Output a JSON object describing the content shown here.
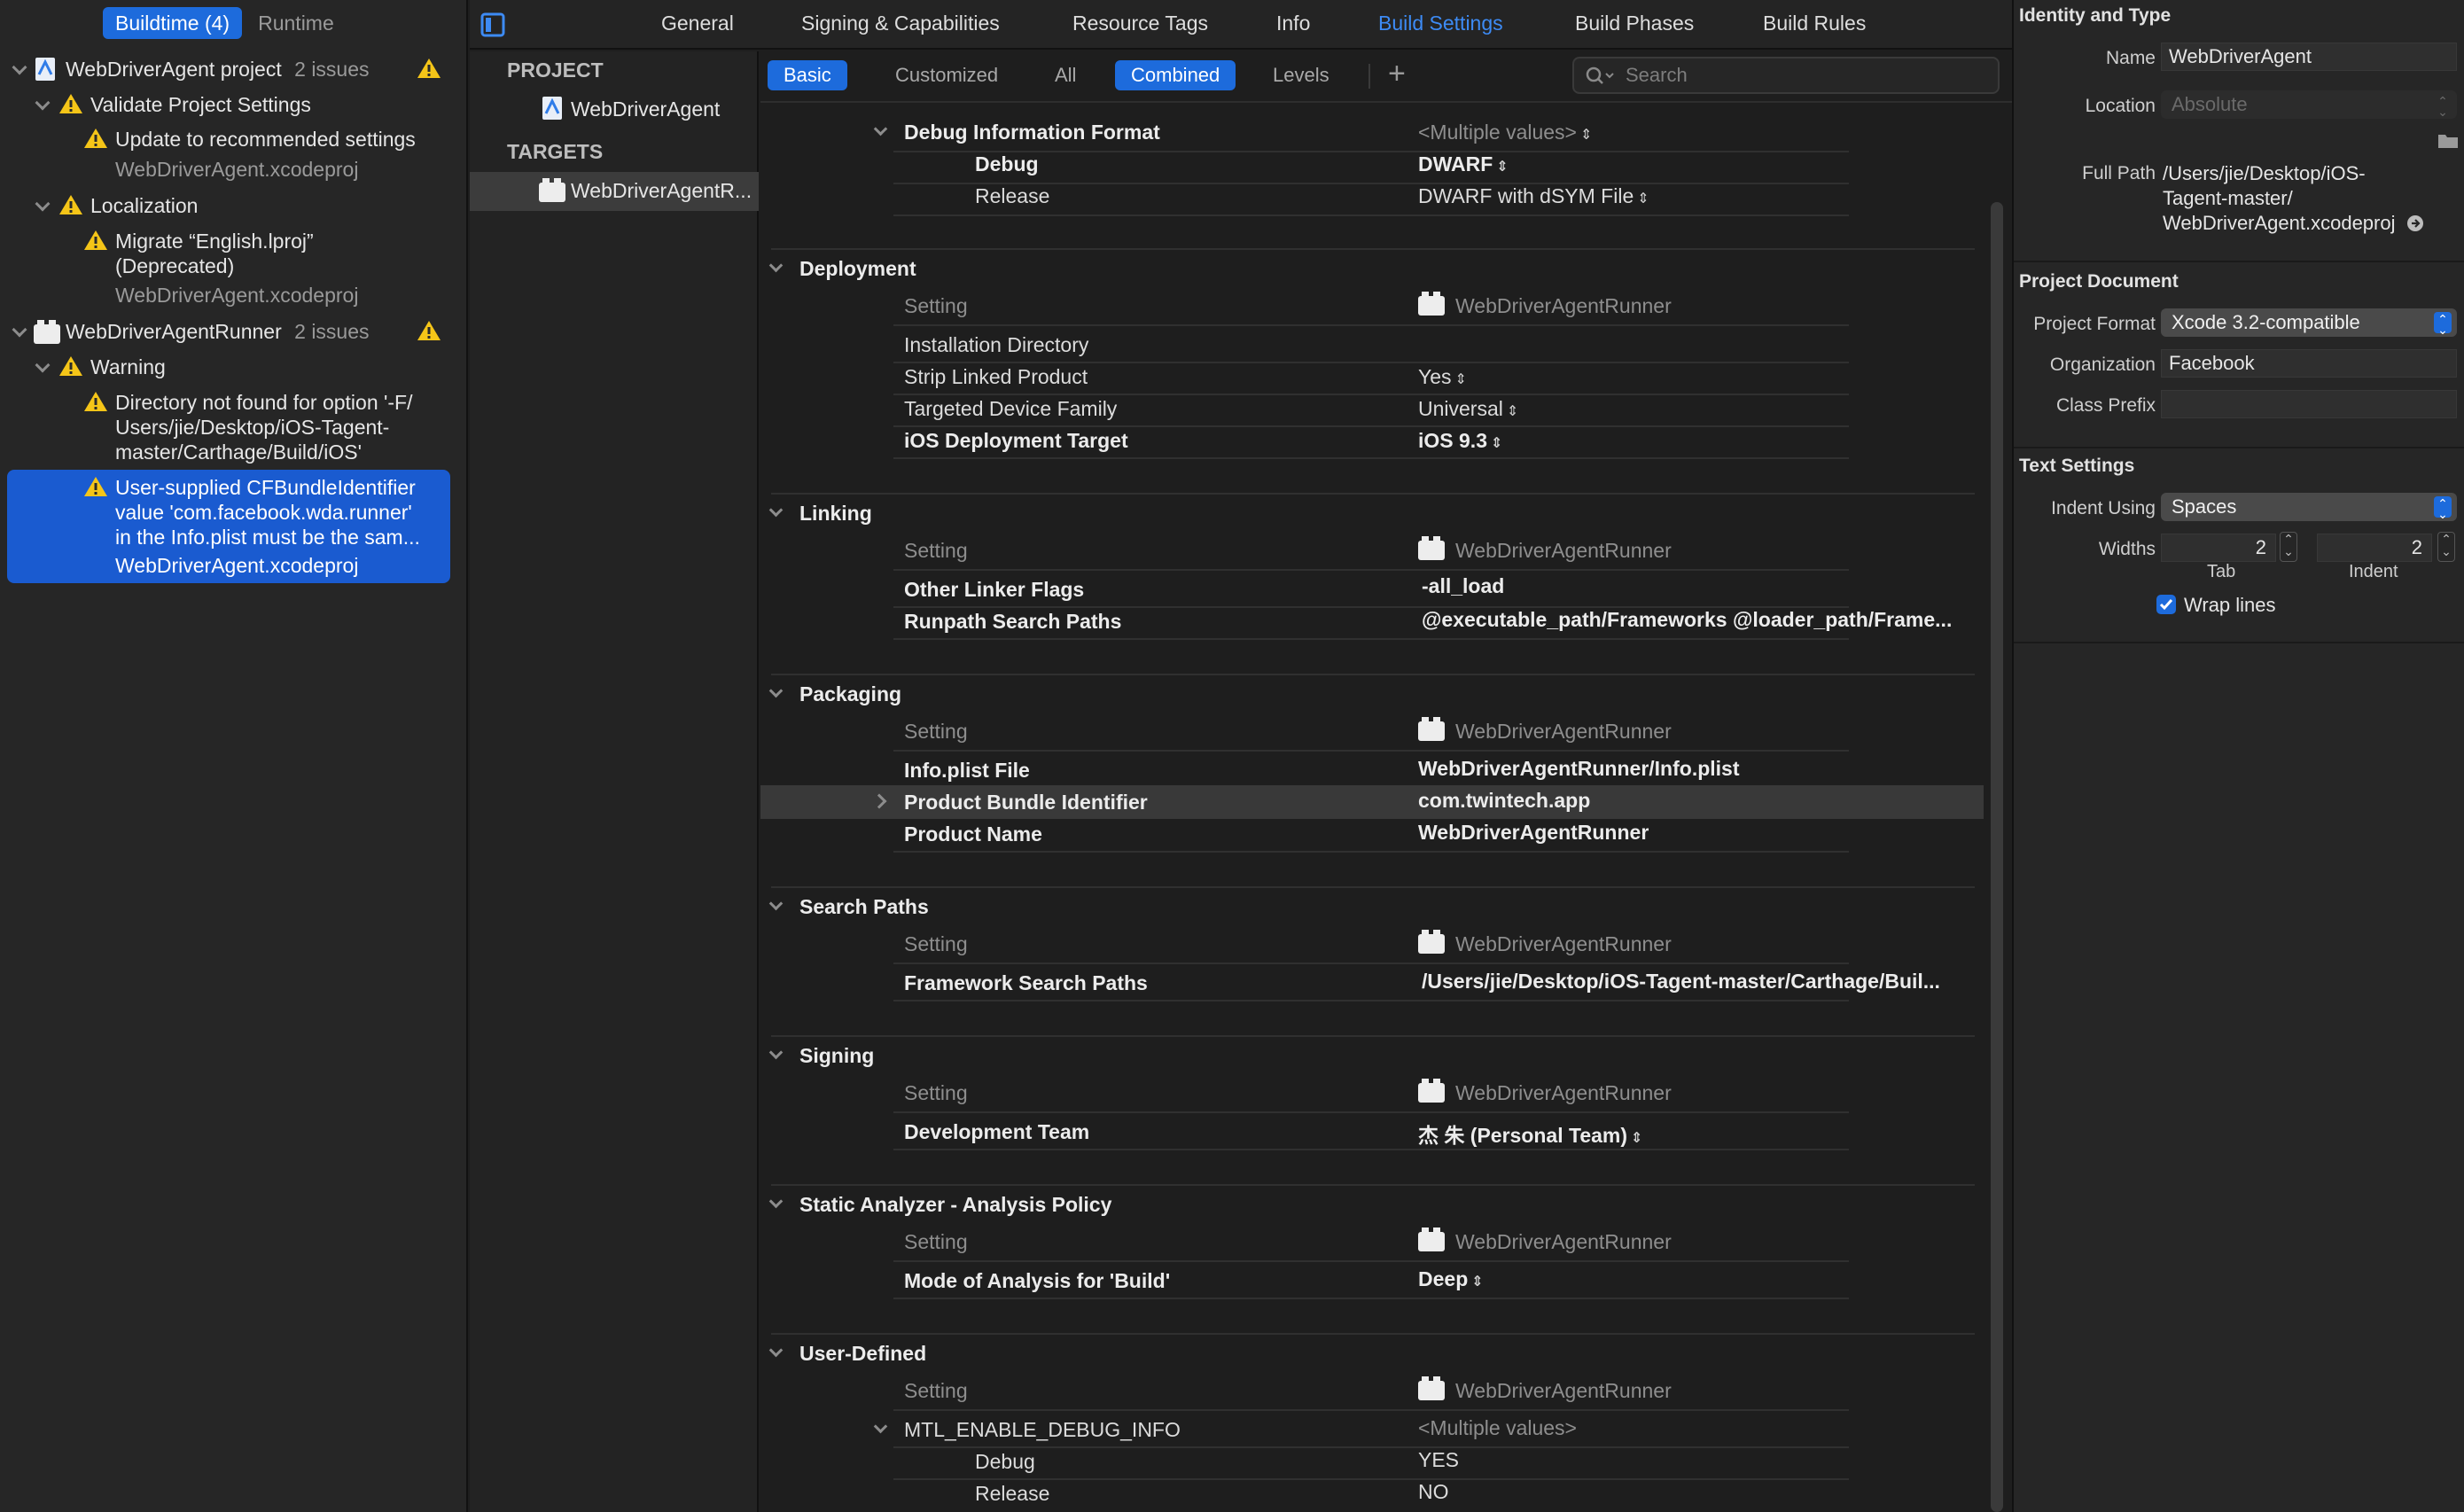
{
  "issues_nav": {
    "segments": [
      "Buildtime (4)",
      "Runtime"
    ],
    "project": {
      "name": "WebDriverAgent project",
      "count": "2 issues"
    },
    "validate_group": "Validate Project Settings",
    "update_item": "Update to recommended settings",
    "update_file": "WebDriverAgent.xcodeproj",
    "localization_group": "Localization",
    "migrate_line1": "Migrate “English.lproj”",
    "migrate_line2": "(Deprecated)",
    "migrate_file": "WebDriverAgent.xcodeproj",
    "runner": {
      "name": "WebDriverAgentRunner",
      "count": "2 issues"
    },
    "warning_group": "Warning",
    "dir_line1": "Directory not found for option '-F/",
    "dir_line2": "Users/jie/Desktop/iOS-Tagent-",
    "dir_line3": "master/Carthage/Build/iOS'",
    "bundle_line1": "User-supplied CFBundleIdentifier",
    "bundle_line2": "value 'com.facebook.wda.runner'",
    "bundle_line3": "in the Info.plist must be the sam...",
    "bundle_file": "WebDriverAgent.xcodeproj"
  },
  "project_list": {
    "project_header": "PROJECT",
    "project_item": "WebDriverAgent",
    "targets_header": "TARGETS",
    "target_item": "WebDriverAgentR..."
  },
  "tabs": [
    "General",
    "Signing & Capabilities",
    "Resource Tags",
    "Info",
    "Build Settings",
    "Build Phases",
    "Build Rules"
  ],
  "filters": {
    "basic": "Basic",
    "customized": "Customized",
    "all": "All",
    "combined": "Combined",
    "levels": "Levels",
    "search_placeholder": "Search"
  },
  "settings": {
    "debug_info": {
      "label": "Debug Information Format",
      "value": "<Multiple values>",
      "debug_label": "Debug",
      "debug_value": "DWARF",
      "release_label": "Release",
      "release_value": "DWARF with dSYM File"
    },
    "column_setting": "Setting",
    "column_target": "WebDriverAgentRunner",
    "deployment": {
      "title": "Deployment",
      "install_dir": "Installation Directory",
      "strip_label": "Strip Linked Product",
      "strip_value": "Yes",
      "family_label": "Targeted Device Family",
      "family_value": "Universal",
      "target_label": "iOS Deployment Target",
      "target_value": "iOS 9.3"
    },
    "linking": {
      "title": "Linking",
      "other_label": "Other Linker Flags",
      "other_value": "-all_load",
      "runpath_label": "Runpath Search Paths",
      "runpath_value": "@executable_path/Frameworks @loader_path/Frame..."
    },
    "packaging": {
      "title": "Packaging",
      "plist_label": "Info.plist File",
      "plist_value": "WebDriverAgentRunner/Info.plist",
      "bundle_label": "Product Bundle Identifier",
      "bundle_value": "com.twintech.app",
      "name_label": "Product Name",
      "name_value": "WebDriverAgentRunner"
    },
    "search_paths": {
      "title": "Search Paths",
      "fw_label": "Framework Search Paths",
      "fw_value": "/Users/jie/Desktop/iOS-Tagent-master/Carthage/Buil..."
    },
    "signing": {
      "title": "Signing",
      "team_label": "Development Team",
      "team_value": "杰 朱 (Personal Team)"
    },
    "analyzer": {
      "title": "Static Analyzer - Analysis Policy",
      "mode_label": "Mode of Analysis for 'Build'",
      "mode_value": "Deep"
    },
    "user_defined": {
      "title": "User-Defined",
      "mtl_label": "MTL_ENABLE_DEBUG_INFO",
      "mtl_value": "<Multiple values>",
      "debug_label": "Debug",
      "debug_value": "YES",
      "release_label": "Release",
      "release_value": "NO"
    }
  },
  "inspector": {
    "identity_title": "Identity and Type",
    "name_label": "Name",
    "name_value": "WebDriverAgent",
    "location_label": "Location",
    "location_value": "Absolute",
    "fullpath_label": "Full Path",
    "fullpath_line1": "/Users/jie/Desktop/iOS-",
    "fullpath_line2": "Tagent-master/",
    "fullpath_line3": "WebDriverAgent.xcodeproj",
    "doc_title": "Project Document",
    "format_label": "Project Format",
    "format_value": "Xcode 3.2-compatible",
    "org_label": "Organization",
    "org_value": "Facebook",
    "prefix_label": "Class Prefix",
    "prefix_value": "",
    "text_title": "Text Settings",
    "indent_label": "Indent Using",
    "indent_value": "Spaces",
    "widths_label": "Widths",
    "tab_value": "2",
    "indent_width_value": "2",
    "tab_caption": "Tab",
    "indent_caption": "Indent",
    "wrap_label": "Wrap lines"
  },
  "colors": {
    "accent": "#1d6bdc",
    "warning": "#f5c518",
    "background": "#1e1e1e"
  }
}
